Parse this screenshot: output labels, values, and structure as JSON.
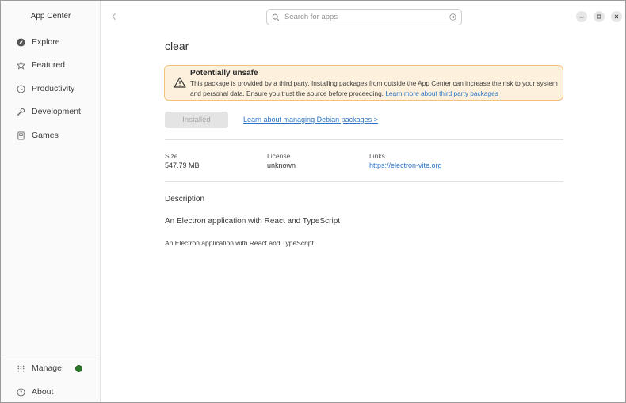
{
  "sidebar": {
    "app_title": "App Center",
    "items": [
      {
        "label": "Explore",
        "icon": "compass-icon"
      },
      {
        "label": "Featured",
        "icon": "star-icon"
      },
      {
        "label": "Productivity",
        "icon": "clock-icon"
      },
      {
        "label": "Development",
        "icon": "wrench-icon"
      },
      {
        "label": "Games",
        "icon": "gamepad-icon"
      }
    ],
    "manage_label": "Manage",
    "about_label": "About",
    "badge_color": "#2b7a2b"
  },
  "header": {
    "search_placeholder": "Search for apps"
  },
  "app": {
    "name": "clear",
    "warning": {
      "title": "Potentially unsafe",
      "text": "This package is provided by a third party. Installing packages from outside the App Center can increase the risk to your system and personal data. Ensure you trust the source before proceeding.",
      "link": "Learn more about third party packages"
    },
    "install_button": "Installed",
    "debian_link": "Learn about managing Debian packages >",
    "meta": {
      "size_label": "Size",
      "size_value": "547.79 MB",
      "license_label": "License",
      "license_value": "unknown",
      "links_label": "Links",
      "links_value": "https://electron-vite.org"
    },
    "description_heading": "Description",
    "description_summary": "An Electron application with React and TypeScript",
    "description_body": "An Electron application with React and TypeScript"
  },
  "colors": {
    "accent_link": "#2a73c6",
    "warning_bg": "#fdf1dd",
    "warning_border": "#f2c27a"
  }
}
